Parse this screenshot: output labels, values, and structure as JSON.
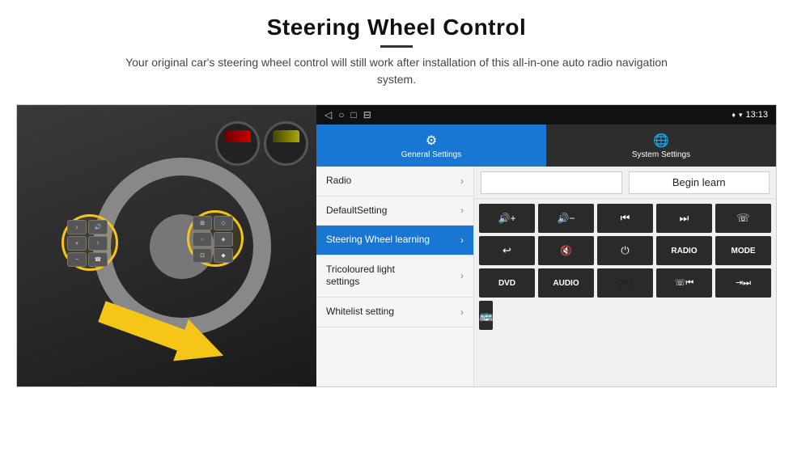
{
  "header": {
    "title": "Steering Wheel Control",
    "subtitle": "Your original car's steering wheel control will still work after installation of this all-in-one auto radio navigation system."
  },
  "android": {
    "statusbar": {
      "time": "13:13",
      "signal_icon": "📶",
      "wifi_icon": "▾",
      "location_icon": "♦"
    },
    "navbar": {
      "back": "◁",
      "home": "○",
      "square": "□",
      "menu": "⋮"
    },
    "tabs": [
      {
        "label": "General Settings",
        "icon": "⚙",
        "active": true
      },
      {
        "label": "System Settings",
        "icon": "🌐",
        "active": false
      }
    ],
    "menu_items": [
      {
        "label": "Radio",
        "active": false
      },
      {
        "label": "DefaultSetting",
        "active": false
      },
      {
        "label": "Steering Wheel learning",
        "active": true
      },
      {
        "label": "Tricoloured light settings",
        "active": false
      },
      {
        "label": "Whitelist setting",
        "active": false
      }
    ],
    "controls": {
      "begin_learn": "Begin learn",
      "row1": [
        "🔊+",
        "🔊-",
        "⏮",
        "⏭",
        "📞"
      ],
      "row1_syms": [
        "◀+",
        "◀-",
        "|◀◀",
        "▶▶|",
        "☏"
      ],
      "row2_syms": [
        "↩",
        "🔇",
        "⏻",
        "RADIO",
        "MODE"
      ],
      "row3_syms": [
        "DVD",
        "AUDIO",
        "GPS",
        "☏|◀",
        "⇥▶▶|"
      ],
      "row4_syms": [
        "🚌"
      ]
    }
  }
}
